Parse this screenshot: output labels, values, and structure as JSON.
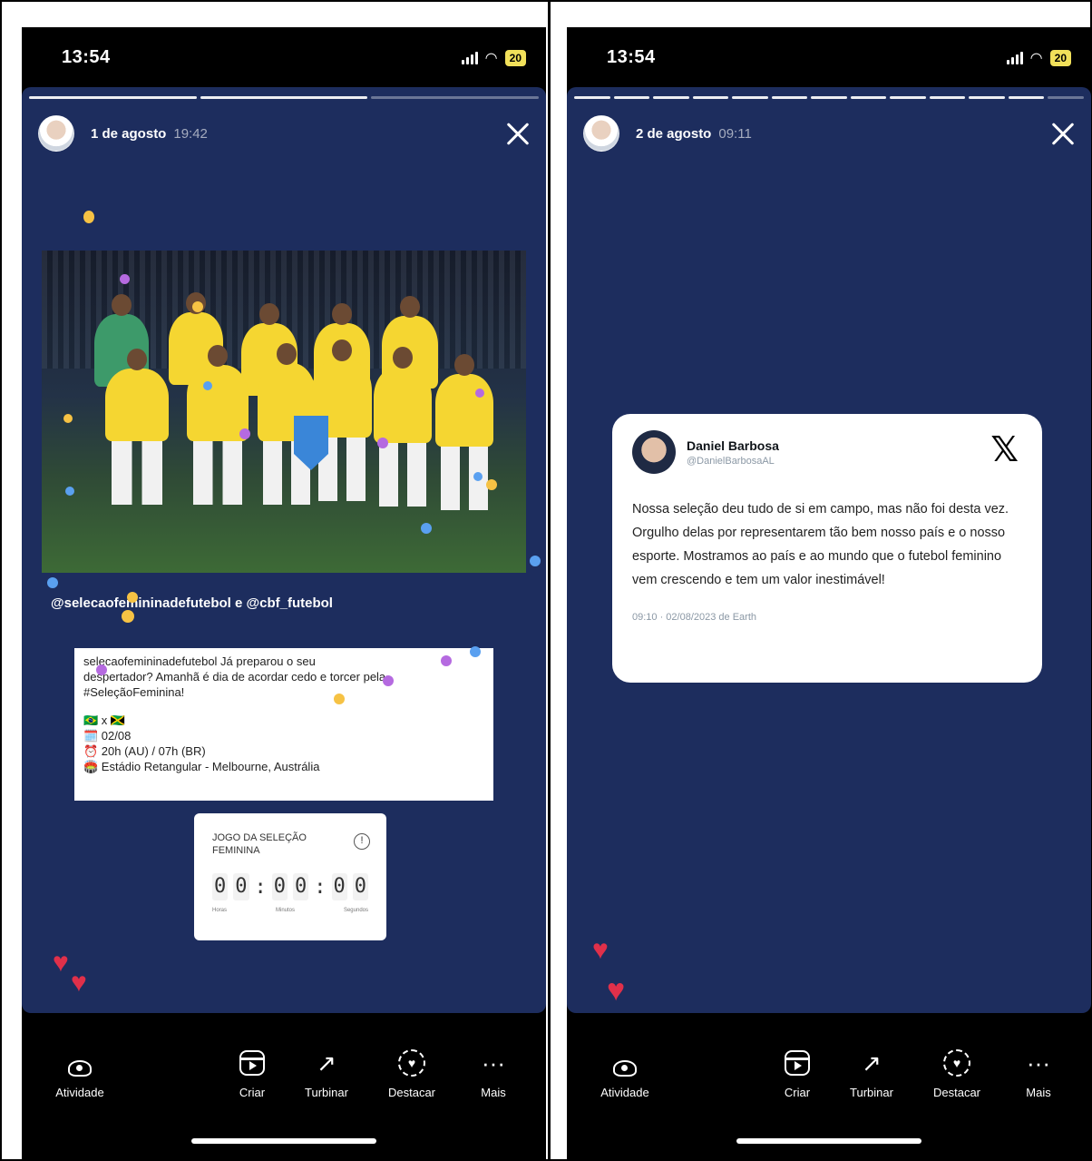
{
  "screens": [
    {
      "status": {
        "time": "13:54",
        "battery": "20"
      },
      "header": {
        "date": "1 de agosto",
        "time": "19:42"
      },
      "story": {
        "mention": "@selecaofemininadefutebol e @cbf_futebol",
        "post_lines": [
          "selecaofemininadefutebol Já preparou o seu",
          "despertador? Amanhã é dia de acordar cedo e torcer pela",
          "#SeleçãoFeminina!",
          "",
          "🇧🇷 x 🇯🇲",
          "🗓️ 02/08",
          "⏰ 20h (AU) / 07h (BR)",
          "🏟️ Estádio Retangular - Melbourne, Austrália"
        ],
        "countdown": {
          "title": "JOGO DA SELEÇÃO FEMININA",
          "digits": [
            "0",
            "0",
            ":",
            "0",
            "0",
            ":",
            "0",
            "0"
          ],
          "units": [
            "Horas",
            "Minutos",
            "Segundos"
          ]
        }
      },
      "progress": {
        "done_segments": 2,
        "total_segments": 3
      }
    },
    {
      "status": {
        "time": "13:54",
        "battery": "20"
      },
      "header": {
        "date": "2 de agosto",
        "time": "09:11"
      },
      "tweet": {
        "name": "Daniel Barbosa",
        "handle": "@DanielBarbosaAL",
        "text": "Nossa seleção deu tudo de si em campo, mas não foi desta vez. Orgulho delas por representarem tão bem nosso país e o nosso esporte. Mostramos ao país e ao mundo que o futebol feminino vem crescendo e tem um valor inestimável!",
        "timestamp": "09:10 · 02/08/2023 de Earth"
      },
      "progress": {
        "done_segments": 12,
        "total_segments": 13
      }
    }
  ],
  "bottom_bar": {
    "items": [
      {
        "label": "Atividade",
        "icon": "activity-eye-icon"
      },
      {
        "label": "Criar",
        "icon": "reels-icon"
      },
      {
        "label": "Turbinar",
        "icon": "boost-trend-icon"
      },
      {
        "label": "Destacar",
        "icon": "highlight-icon"
      },
      {
        "label": "Mais",
        "icon": "more-dots-icon"
      }
    ]
  },
  "colors": {
    "story_bg": "#1d2d5e",
    "heart": "#e0304a",
    "battery": "#f1e05a"
  }
}
